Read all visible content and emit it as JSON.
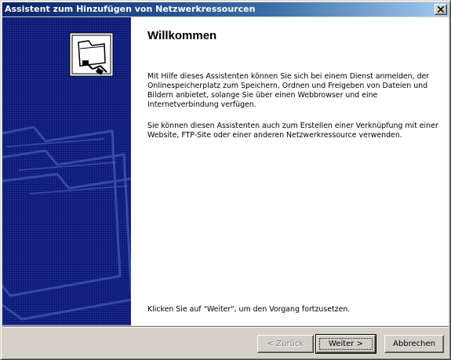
{
  "window": {
    "title": "Assistent zum Hinzufügen von Netzwerkressourcen"
  },
  "main": {
    "heading": "Willkommen",
    "paragraph1": "Mit Hilfe dieses Assistenten können Sie sich bei einem Dienst anmelden, der Onlinespeicherplatz zum Speichern, Ordnen und Freigeben von Dateien und Bildern anbietet, solange Sie über einen Webbrowser und eine Internetverbindung verfügen.",
    "paragraph2": "Sie können diesen Assistenten auch zum Erstellen einer Verknüpfung mit einer Website, FTP-Site oder einer anderen Netzwerkressource verwenden.",
    "footer_hint": "Klicken Sie auf \"Weiter\", um den Vorgang fortzusetzen."
  },
  "buttons": {
    "back_label": "< Zurück",
    "next_label": "Weiter >",
    "cancel_label": "Abbrechen"
  },
  "colors": {
    "sidebar": "#0a1978",
    "titlebar_start": "#0a246a",
    "titlebar_end": "#a6caf0"
  },
  "icons": {
    "sidebar_icon": "network-folder-icon",
    "close": "close-icon"
  }
}
